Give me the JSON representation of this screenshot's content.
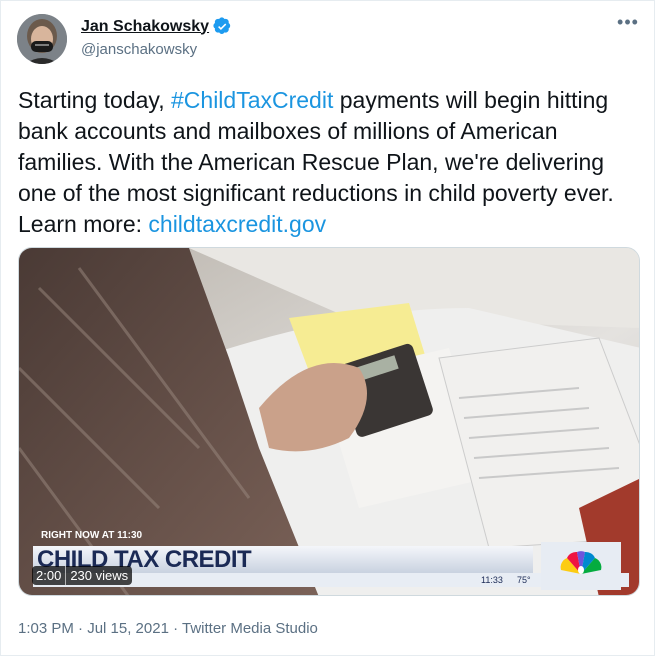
{
  "author": {
    "name": "Jan Schakowsky",
    "handle": "@janschakowsky",
    "verified": true,
    "avatar_icon": "avatar-photo"
  },
  "tweet": {
    "text_part1": "Starting today, ",
    "hashtag": "#ChildTaxCredit",
    "text_part2": " payments will begin hitting bank accounts and mailboxes of millions of American families. With the American Rescue Plan, we're delivering one of the most significant reductions in child poverty ever. Learn more: ",
    "link": "childtaxcredit.gov"
  },
  "video": {
    "chyron_top": "RIGHT NOW AT 11:30",
    "chyron_main": "CHILD TAX CREDIT",
    "chyron_time": "11:33",
    "chyron_temp": "75°",
    "duration": "2:00",
    "views": "230 views"
  },
  "meta": {
    "timestamp": "1:03 PM · Jul 15, 2021 · ",
    "source": "Twitter Media Studio"
  },
  "colors": {
    "link": "#1b95e0",
    "verified": "#1d9bf0",
    "secondary_text": "#5b7083"
  },
  "icons": {
    "more": "more-options-icon",
    "verified": "verified-badge-icon"
  }
}
